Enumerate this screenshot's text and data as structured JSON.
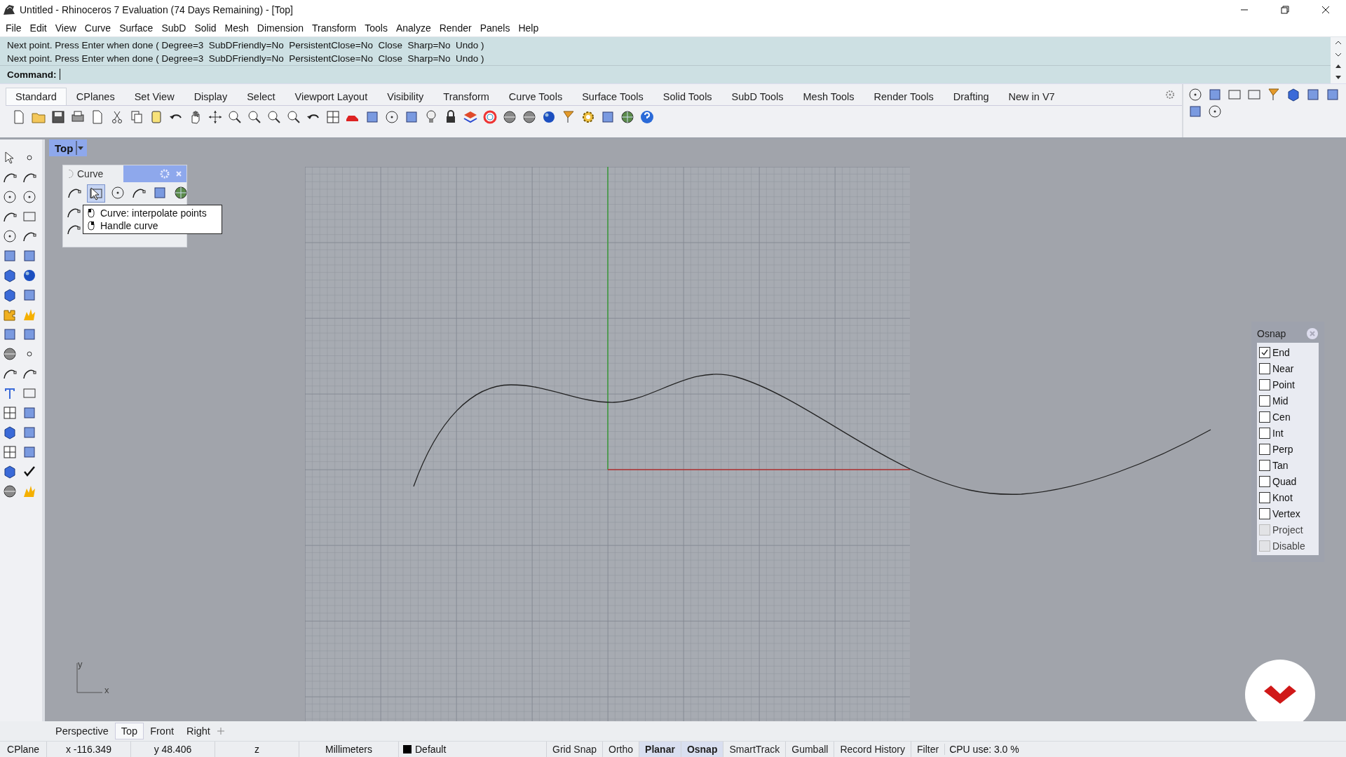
{
  "window": {
    "title": "Untitled - Rhinoceros 7 Evaluation (74 Days Remaining) - [Top]"
  },
  "menu": [
    "File",
    "Edit",
    "View",
    "Curve",
    "Surface",
    "SubD",
    "Solid",
    "Mesh",
    "Dimension",
    "Transform",
    "Tools",
    "Analyze",
    "Render",
    "Panels",
    "Help"
  ],
  "command_history": [
    "Next point. Press Enter when done ( Degree=3  SubDFriendly=No  PersistentClose=No  Close  Sharp=No  Undo )",
    "Next point. Press Enter when done ( Degree=3  SubDFriendly=No  PersistentClose=No  Close  Sharp=No  Undo )"
  ],
  "command_prompt": {
    "label": "Command:"
  },
  "toolbar_tabs": [
    {
      "label": "Standard",
      "selected": true
    },
    {
      "label": "CPlanes",
      "selected": false
    },
    {
      "label": "Set View",
      "selected": false
    },
    {
      "label": "Display",
      "selected": false
    },
    {
      "label": "Select",
      "selected": false
    },
    {
      "label": "Viewport Layout",
      "selected": false
    },
    {
      "label": "Visibility",
      "selected": false
    },
    {
      "label": "Transform",
      "selected": false
    },
    {
      "label": "Curve Tools",
      "selected": false
    },
    {
      "label": "Surface Tools",
      "selected": false
    },
    {
      "label": "Solid Tools",
      "selected": false
    },
    {
      "label": "SubD Tools",
      "selected": false
    },
    {
      "label": "Mesh Tools",
      "selected": false
    },
    {
      "label": "Render Tools",
      "selected": false
    },
    {
      "label": "Drafting",
      "selected": false
    },
    {
      "label": "New in V7",
      "selected": false
    }
  ],
  "viewport": {
    "title": "Top",
    "axis_y": "y",
    "axis_x": "x"
  },
  "curve_toolbar": {
    "title": "Curve"
  },
  "tooltip": {
    "lines": [
      "Curve: interpolate points",
      "Handle curve"
    ]
  },
  "osnap": {
    "title": "Osnap",
    "items": [
      {
        "label": "End",
        "checked": true,
        "disabled": false
      },
      {
        "label": "Near",
        "checked": false,
        "disabled": false
      },
      {
        "label": "Point",
        "checked": false,
        "disabled": false
      },
      {
        "label": "Mid",
        "checked": false,
        "disabled": false
      },
      {
        "label": "Cen",
        "checked": false,
        "disabled": false
      },
      {
        "label": "Int",
        "checked": false,
        "disabled": false
      },
      {
        "label": "Perp",
        "checked": false,
        "disabled": false
      },
      {
        "label": "Tan",
        "checked": false,
        "disabled": false
      },
      {
        "label": "Quad",
        "checked": false,
        "disabled": false
      },
      {
        "label": "Knot",
        "checked": false,
        "disabled": false
      },
      {
        "label": "Vertex",
        "checked": false,
        "disabled": false
      },
      {
        "label": "Project",
        "checked": false,
        "disabled": true
      },
      {
        "label": "Disable",
        "checked": false,
        "disabled": true
      }
    ]
  },
  "view_tabs": [
    {
      "label": "Perspective",
      "selected": false
    },
    {
      "label": "Top",
      "selected": true
    },
    {
      "label": "Front",
      "selected": false
    },
    {
      "label": "Right",
      "selected": false
    }
  ],
  "status_bar": {
    "cplane": "CPlane",
    "x": "x -116.349",
    "y": "y 48.406",
    "z": "z",
    "units": "Millimeters",
    "layer": "Default",
    "toggles": [
      {
        "label": "Grid Snap",
        "on": false
      },
      {
        "label": "Ortho",
        "on": false
      },
      {
        "label": "Planar",
        "on": true
      },
      {
        "label": "Osnap",
        "on": true
      },
      {
        "label": "SmartTrack",
        "on": false
      },
      {
        "label": "Gumball",
        "on": false
      },
      {
        "label": "Record History",
        "on": false
      },
      {
        "label": "Filter",
        "on": false
      }
    ],
    "cpu": "CPU use: 3.0 %"
  }
}
